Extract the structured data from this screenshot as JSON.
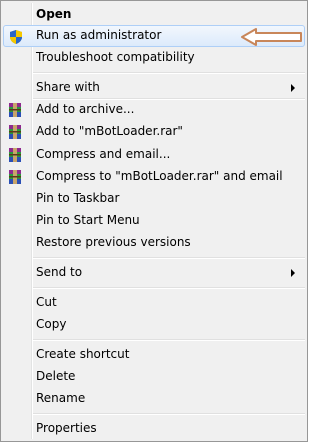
{
  "menu": {
    "open": "Open",
    "run_as_admin": "Run as administrator",
    "troubleshoot": "Troubleshoot compatibility",
    "share_with": "Share with",
    "add_archive": "Add to archive...",
    "add_rar": "Add to \"mBotLoader.rar\"",
    "compress_email": "Compress and email...",
    "compress_rar_email": "Compress to \"mBotLoader.rar\" and email",
    "pin_taskbar": "Pin to Taskbar",
    "pin_start": "Pin to Start Menu",
    "restore": "Restore previous versions",
    "send_to": "Send to",
    "cut": "Cut",
    "copy": "Copy",
    "create_shortcut": "Create shortcut",
    "delete": "Delete",
    "rename": "Rename",
    "properties": "Properties"
  },
  "icons": {
    "shield": "uac-shield-icon",
    "winrar": "winrar-icon",
    "submenu": "chevron-right-icon",
    "callout": "arrow-callout-icon"
  },
  "colors": {
    "highlight_border": "#aecff7",
    "callout_arrow": "#c8865a"
  }
}
